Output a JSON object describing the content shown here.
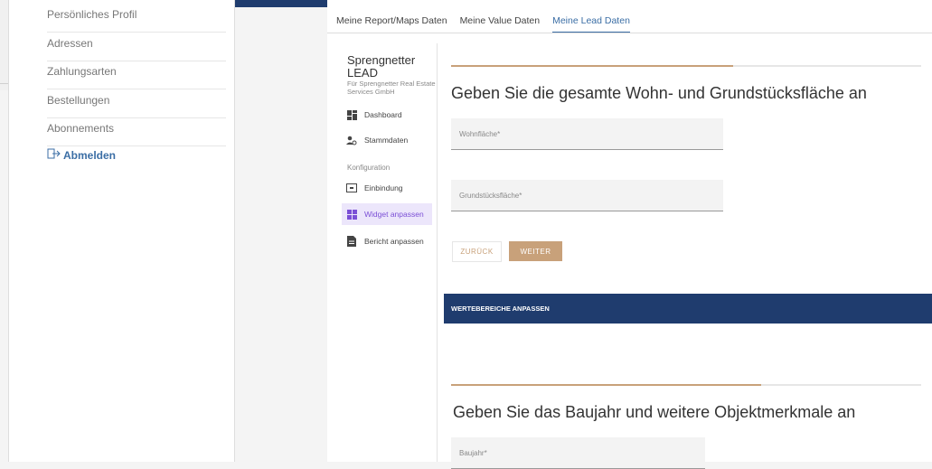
{
  "sidebar": {
    "items": [
      {
        "label": "Persönliches Profil"
      },
      {
        "label": "Adressen"
      },
      {
        "label": "Zahlungsarten"
      },
      {
        "label": "Bestellungen"
      },
      {
        "label": "Abonnements"
      }
    ],
    "logout_label": "Abmelden",
    "accent_color": "#3b6ea5"
  },
  "tabs": [
    {
      "label": "Meine Report/Maps Daten"
    },
    {
      "label": "Meine Value Daten"
    },
    {
      "label": "Meine Lead Daten",
      "active": true
    }
  ],
  "app": {
    "title": "Sprengnetter\nLEAD",
    "subtitle": "Für Sprengnetter Real Estate Services GmbH",
    "nav": [
      {
        "label": "Dashboard",
        "icon": "dashboard-icon"
      },
      {
        "label": "Stammdaten",
        "icon": "users-icon"
      }
    ],
    "config_section": "Konfiguration",
    "config_nav": [
      {
        "label": "Einbindung",
        "icon": "embed-icon"
      },
      {
        "label": "Widget anpassen",
        "icon": "widget-icon",
        "active": true
      },
      {
        "label": "Bericht anpassen",
        "icon": "document-icon"
      }
    ]
  },
  "step1": {
    "heading": "Geben Sie die gesamte Wohn- und Grundstücksfläche an",
    "field_living_area": "Wohnfläche*",
    "field_plot_area": "Grundstücksfläche*",
    "back_label": "ZURÜCK",
    "next_label": "WEITER",
    "progress": 0.6
  },
  "section_bar": {
    "label": "WERTEBEREICHE ANPASSEN",
    "color": "#1f3c6e"
  },
  "step2": {
    "heading": "Geben Sie das Baujahr und weitere Objektmerkmale an",
    "field_year": "Baujahr*",
    "progress": 0.66
  },
  "colors": {
    "gold": "#c8a17a",
    "navy": "#1f3c6e",
    "purple": "#7b4fd6"
  }
}
